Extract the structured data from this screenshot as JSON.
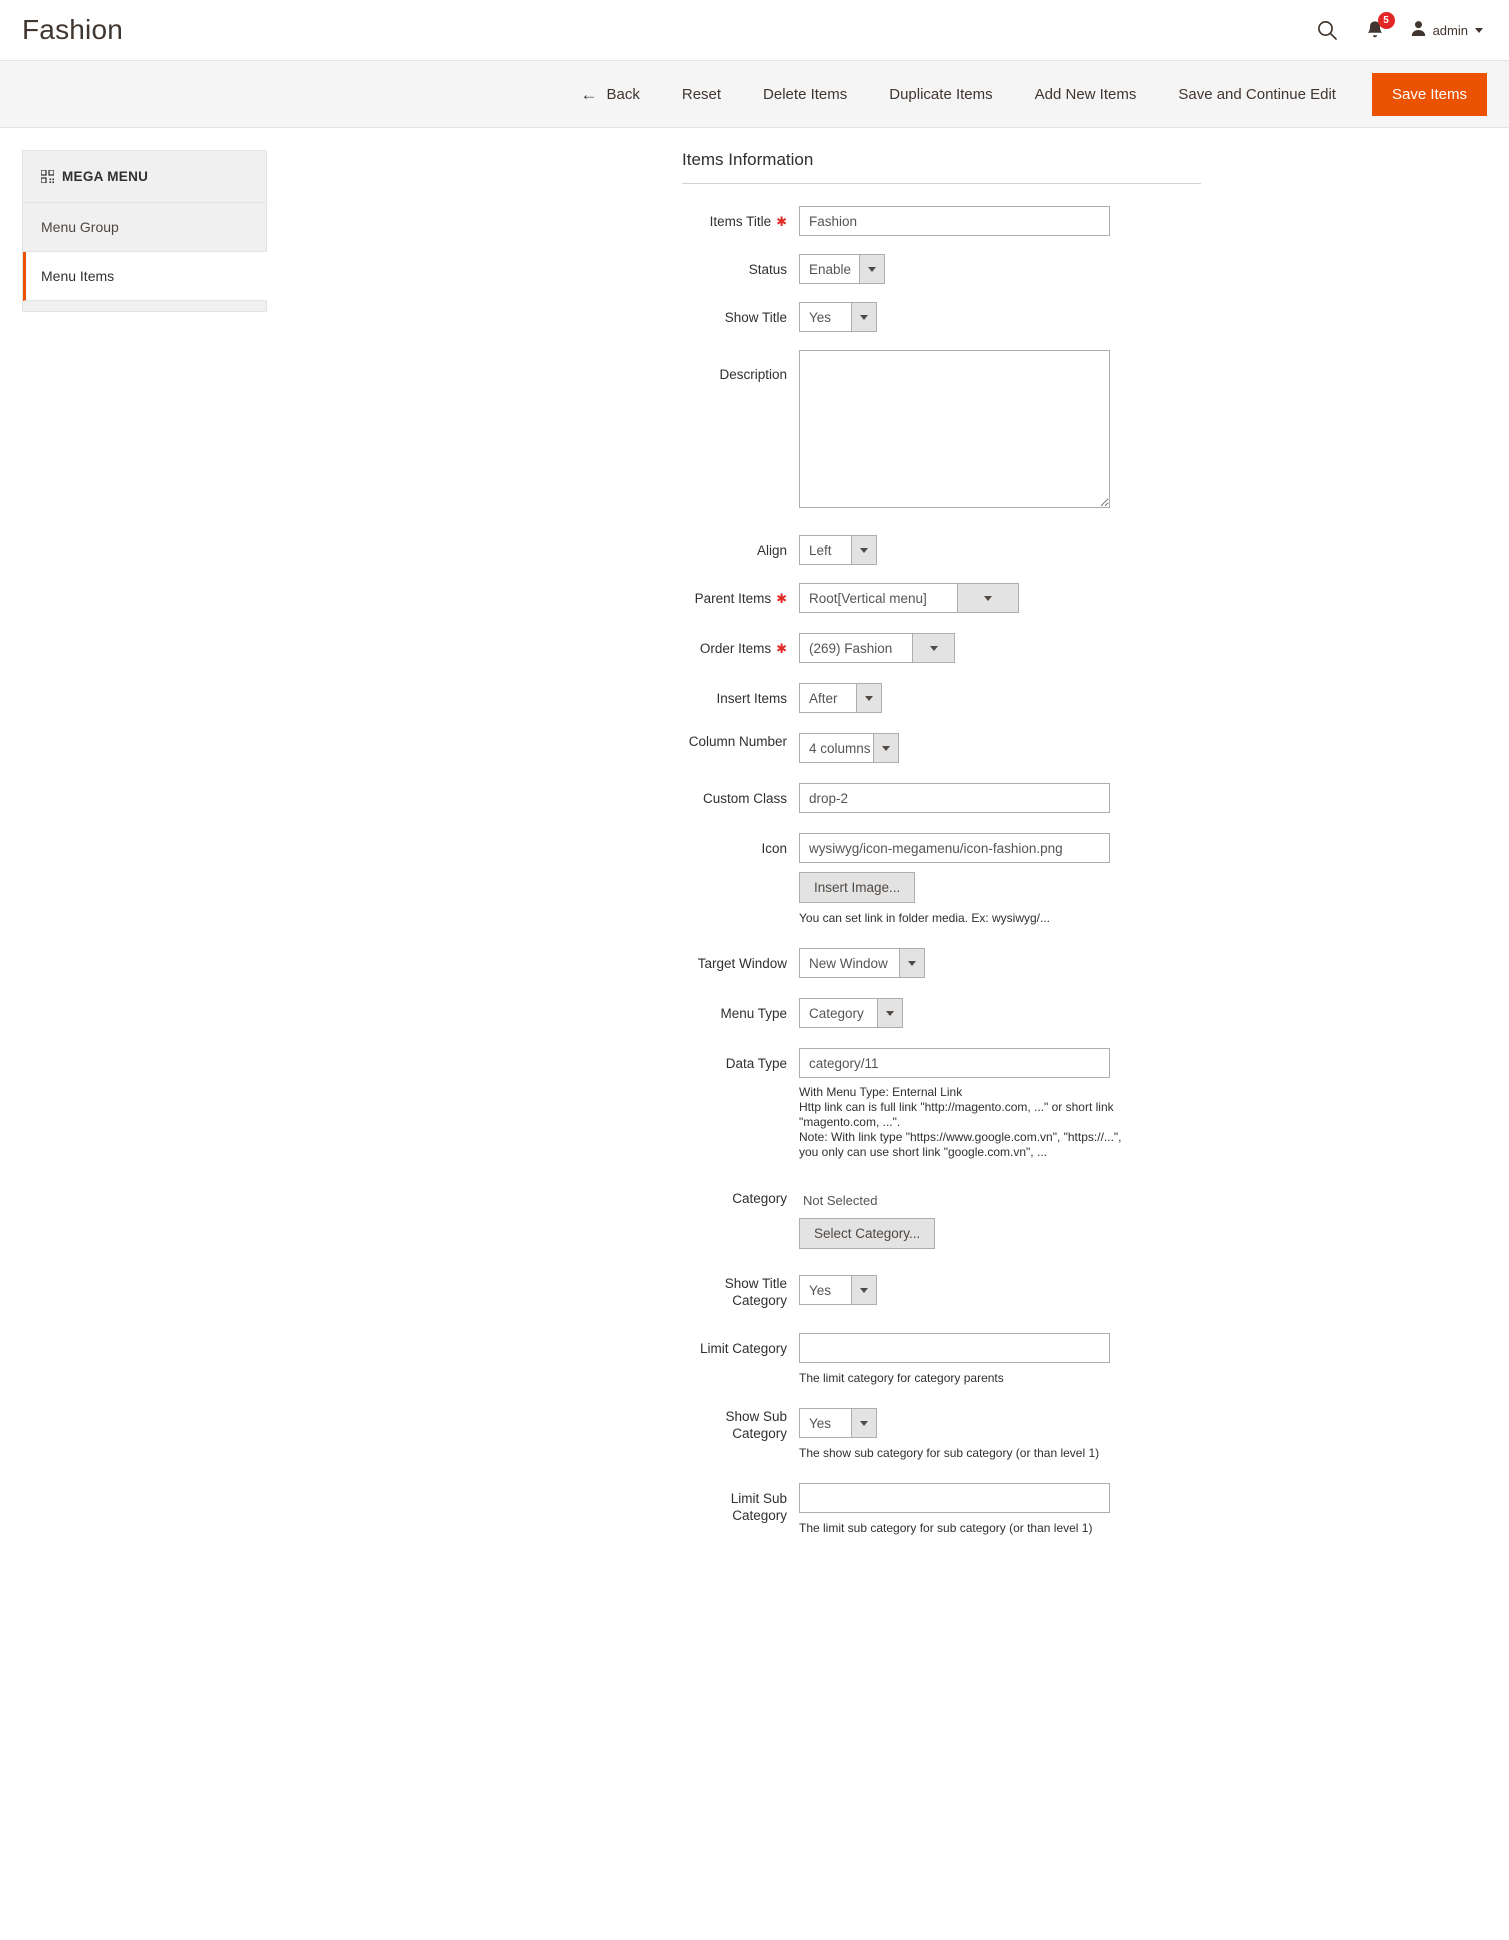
{
  "header": {
    "title": "Fashion",
    "search_icon": "search-icon",
    "notifications_icon": "bell-icon",
    "notifications_count": "5",
    "user_icon": "user-icon",
    "user_label": "admin"
  },
  "toolbar": {
    "back_label": "Back",
    "back_icon": "arrow-left-icon",
    "reset_label": "Reset",
    "delete_label": "Delete Items",
    "duplicate_label": "Duplicate Items",
    "add_new_label": "Add New Items",
    "save_continue_label": "Save and Continue Edit",
    "save_label": "Save Items",
    "primary_color": "#eb5202"
  },
  "sidebar": {
    "title": "MEGA MENU",
    "title_icon": "grid-icon",
    "items": [
      {
        "label": "Menu Group",
        "active": false
      },
      {
        "label": "Menu Items",
        "active": true
      }
    ],
    "active_accent": "#eb5202"
  },
  "form": {
    "section_title": "Items Information",
    "items_title": {
      "label": "Items Title",
      "required": true,
      "value": "Fashion"
    },
    "status": {
      "label": "Status",
      "value": "Enable"
    },
    "show_title": {
      "label": "Show Title",
      "value": "Yes"
    },
    "description": {
      "label": "Description",
      "value": ""
    },
    "align": {
      "label": "Align",
      "value": "Left"
    },
    "parent_items": {
      "label": "Parent Items",
      "required": true,
      "value": "Root[Vertical menu]"
    },
    "order_items": {
      "label": "Order Items",
      "required": true,
      "value": "(269) Fashion"
    },
    "insert_items": {
      "label": "Insert Items",
      "value": "After"
    },
    "column_number": {
      "label": "Column Number",
      "value": "4 columns"
    },
    "custom_class": {
      "label": "Custom Class",
      "value": "drop-2"
    },
    "icon": {
      "label": "Icon",
      "value": "wysiwyg/icon-megamenu/icon-fashion.png",
      "button_label": "Insert Image...",
      "note": "You can set link in folder media. Ex: wysiwyg/..."
    },
    "target_window": {
      "label": "Target Window",
      "value": "New Window"
    },
    "menu_type": {
      "label": "Menu Type",
      "value": "Category"
    },
    "data_type": {
      "label": "Data Type",
      "value": "category/11",
      "note": "With Menu Type: Enternal Link\nHttp link can is full link \"http://magento.com, ...\" or short link\n\"magento.com, ...\".\nNote: With link type \"https://www.google.com.vn\", \"https://...\",\nyou only can use short link \"google.com.vn\", ..."
    },
    "category": {
      "label": "Category",
      "value": "Not Selected",
      "button_label": "Select Category..."
    },
    "show_title_category": {
      "label": "Show Title Category",
      "value": "Yes"
    },
    "limit_category": {
      "label": "Limit Category",
      "value": "",
      "note": "The limit category for category parents"
    },
    "show_sub_category": {
      "label": "Show Sub Category",
      "value": "Yes",
      "note": "The show sub category for sub category (or than level 1)"
    },
    "limit_sub_category": {
      "label": "Limit Sub Category",
      "value": "",
      "note": "The limit sub category for sub category (or than level 1)"
    }
  }
}
